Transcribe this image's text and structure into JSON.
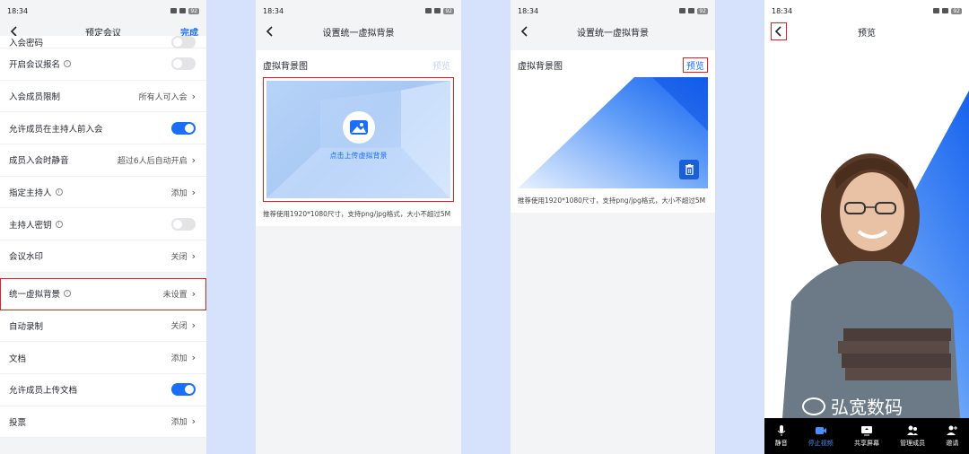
{
  "status": {
    "time": "18:34",
    "battery": "92"
  },
  "panel1": {
    "title": "预定会议",
    "done": "完成",
    "rows": [
      {
        "label": "入会密码",
        "type": "toggle",
        "on": false
      },
      {
        "label": "开启会议报名",
        "info": true,
        "type": "toggle",
        "on": false
      },
      {
        "label": "入会成员限制",
        "value": "所有人可入会",
        "type": "link"
      },
      {
        "label": "允许成员在主持人前入会",
        "type": "toggle",
        "on": true
      },
      {
        "label": "成员入会时静音",
        "value": "超过6人后自动开启",
        "type": "link"
      },
      {
        "label": "指定主持人",
        "info": true,
        "value": "添加",
        "type": "link"
      },
      {
        "label": "主持人密钥",
        "info": true,
        "type": "toggle",
        "on": false
      },
      {
        "label": "会议水印",
        "value": "关闭",
        "type": "link"
      },
      {
        "label": "统一虚拟背景",
        "info": true,
        "value": "未设置",
        "type": "link",
        "highlight": true
      },
      {
        "label": "自动录制",
        "value": "关闭",
        "type": "link"
      },
      {
        "label": "文档",
        "value": "添加",
        "type": "link"
      },
      {
        "label": "允许成员上传文档",
        "type": "toggle",
        "on": true
      },
      {
        "label": "投票",
        "value": "添加",
        "type": "link"
      }
    ]
  },
  "panel2": {
    "title": "设置统一虚拟背景",
    "label": "虚拟背景图",
    "preview": "预览",
    "upload": "点击上传虚拟背景",
    "hint": "推荐使用1920*1080尺寸，支持png/jpg格式，大小不超过5M"
  },
  "panel3": {
    "title": "设置统一虚拟背景",
    "label": "虚拟背景图",
    "preview": "预览",
    "hint": "推荐使用1920*1080尺寸，支持png/jpg格式，大小不超过5M"
  },
  "panel4": {
    "title": "预览",
    "watermark": "弘宽数码",
    "toolbar": [
      "静音",
      "停止视频",
      "共享屏幕",
      "管理成员",
      "邀请"
    ]
  },
  "colors": {
    "accent": "#1a6ff5",
    "highlight": "#e02020"
  }
}
